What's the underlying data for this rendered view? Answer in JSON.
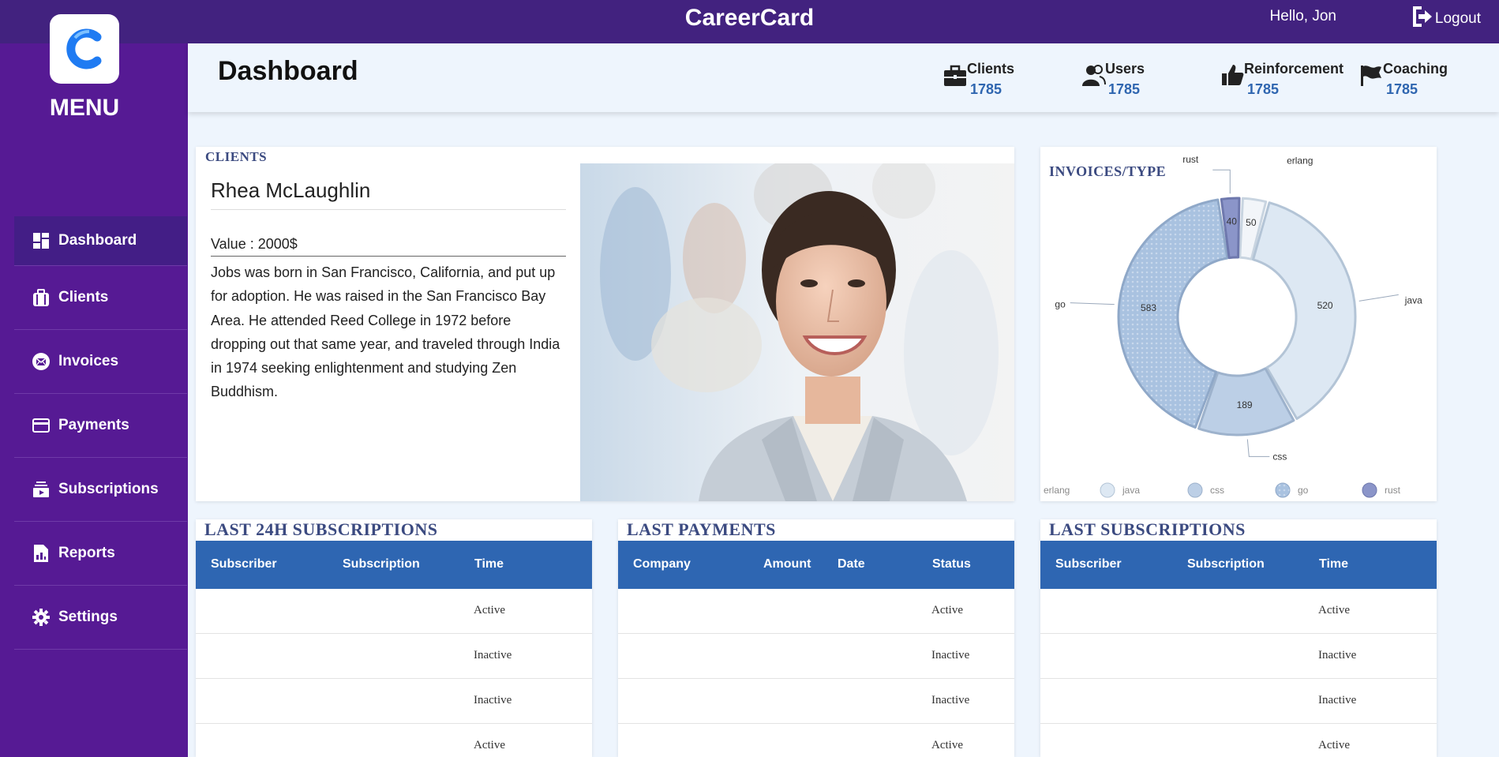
{
  "app": {
    "title": "CareerCard",
    "greeting": "Hello, Jon",
    "logout_label": "Logout"
  },
  "sidebar": {
    "menu_title": "MENU",
    "items": [
      {
        "label": "Dashboard",
        "icon": "dashboard-icon",
        "active": true
      },
      {
        "label": "Clients",
        "icon": "briefcase-icon"
      },
      {
        "label": "Invoices",
        "icon": "envelope-icon"
      },
      {
        "label": "Payments",
        "icon": "credit-card-icon"
      },
      {
        "label": "Subscriptions",
        "icon": "subscriptions-icon"
      },
      {
        "label": "Reports",
        "icon": "report-icon"
      },
      {
        "label": "Settings",
        "icon": "gear-icon"
      }
    ]
  },
  "header": {
    "title": "Dashboard",
    "stats": [
      {
        "label": "Clients",
        "value": "1785",
        "icon": "briefcase-icon"
      },
      {
        "label": "Users",
        "value": "1785",
        "icon": "users-icon"
      },
      {
        "label": "Reinforcement",
        "value": "1785",
        "icon": "thumbs-up-icon"
      },
      {
        "label": "Coaching",
        "value": "1785",
        "icon": "flag-icon"
      }
    ]
  },
  "client": {
    "heading": "CLIENTS",
    "name": "Rhea McLaughlin",
    "value": "Value : 2000$",
    "bio": "Jobs was born in San Francisco, California, and put up for adoption. He was raised in the San Francisco Bay Area. He attended Reed College in 1972 before dropping out that same year, and traveled through India in 1974 seeking enlightenment and studying Zen Buddhism."
  },
  "invoices": {
    "heading": "INVOICES/TYPE"
  },
  "chart_data": {
    "type": "pie",
    "title": "INVOICES/TYPE",
    "categories": [
      "erlang",
      "java",
      "css",
      "go",
      "rust"
    ],
    "values": [
      50,
      520,
      189,
      583,
      40
    ],
    "legend": [
      "erlang",
      "java",
      "css",
      "go",
      "rust"
    ],
    "legend_position": "bottom",
    "donut": true
  },
  "tables": [
    {
      "heading": "LAST 24H SUBSCRIPTIONS",
      "columns": [
        "Subscriber",
        "Subscription",
        "Time"
      ],
      "rows": [
        {
          "status": "Active"
        },
        {
          "status": "Inactive"
        },
        {
          "status": "Inactive"
        },
        {
          "status": "Active"
        }
      ]
    },
    {
      "heading": "LAST PAYMENTS",
      "columns": [
        "Company",
        "Amount",
        "Date",
        "Status"
      ],
      "rows": [
        {
          "status": "Active"
        },
        {
          "status": "Inactive"
        },
        {
          "status": "Inactive"
        },
        {
          "status": "Active"
        }
      ]
    },
    {
      "heading": "LAST SUBSCRIPTIONS",
      "columns": [
        "Subscriber",
        "Subscription",
        "Time"
      ],
      "rows": [
        {
          "status": "Active"
        },
        {
          "status": "Inactive"
        },
        {
          "status": "Inactive"
        },
        {
          "status": "Active"
        }
      ]
    }
  ],
  "colors": {
    "topbar": "#42227f",
    "sidebar": "#561a94",
    "accent": "#2e66b2",
    "heading": "#3b4a80"
  }
}
